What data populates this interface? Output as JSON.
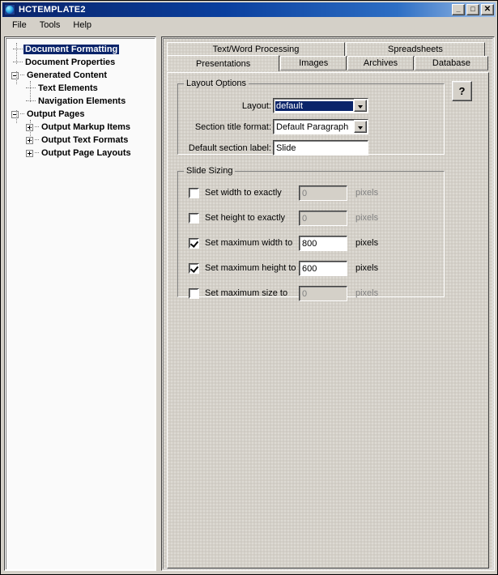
{
  "window": {
    "title": "HCTEMPLATE2",
    "icon": "globe-icon",
    "buttons": {
      "minimize": "_",
      "maximize": "□",
      "close": "✕"
    }
  },
  "menubar": {
    "items": [
      {
        "label": "File"
      },
      {
        "label": "Tools"
      },
      {
        "label": "Help"
      }
    ]
  },
  "tree": {
    "items": [
      {
        "label": "Document Formatting",
        "indent": 1,
        "toggle": "none",
        "selected": true
      },
      {
        "label": "Document Properties",
        "indent": 1,
        "toggle": "none",
        "selected": false
      },
      {
        "label": "Generated Content",
        "indent": 0,
        "toggle": "minus",
        "selected": false
      },
      {
        "label": "Text Elements",
        "indent": 2,
        "toggle": "none",
        "selected": false
      },
      {
        "label": "Navigation Elements",
        "indent": 2,
        "toggle": "none",
        "selected": false
      },
      {
        "label": "Output Pages",
        "indent": 0,
        "toggle": "minus",
        "selected": false
      },
      {
        "label": "Output Markup Items",
        "indent": 1,
        "toggle": "plus",
        "selected": false
      },
      {
        "label": "Output Text Formats",
        "indent": 1,
        "toggle": "plus",
        "selected": false
      },
      {
        "label": "Output Page Layouts",
        "indent": 1,
        "toggle": "plus",
        "selected": false
      }
    ]
  },
  "tabs": {
    "row1": [
      {
        "label": "Text/Word Processing",
        "active": false
      },
      {
        "label": "Spreadsheets",
        "active": false
      }
    ],
    "row2": [
      {
        "label": "Presentations",
        "active": true
      },
      {
        "label": "Images",
        "active": false
      },
      {
        "label": "Archives",
        "active": false
      },
      {
        "label": "Database",
        "active": false
      }
    ]
  },
  "help_button": {
    "label": "?"
  },
  "layout_options": {
    "title": "Layout Options",
    "layout": {
      "label": "Layout:",
      "value": "default",
      "focused": true
    },
    "section_title_format": {
      "label": "Section title format:",
      "value": "Default Paragraph",
      "focused": false
    },
    "default_section_label": {
      "label": "Default section label:",
      "value": "Slide"
    }
  },
  "slide_sizing": {
    "title": "Slide Sizing",
    "unit": "pixels",
    "rows": [
      {
        "label": "Set width to exactly",
        "checked": false,
        "value": "0",
        "enabled": false
      },
      {
        "label": "Set height to exactly",
        "checked": false,
        "value": "0",
        "enabled": false
      },
      {
        "label": "Set maximum width to",
        "checked": true,
        "value": "800",
        "enabled": true
      },
      {
        "label": "Set maximum height to",
        "checked": true,
        "value": "600",
        "enabled": true
      },
      {
        "label": "Set maximum size to",
        "checked": false,
        "value": "0",
        "enabled": false
      }
    ]
  },
  "colors": {
    "face": "#d4d0c8",
    "title_active": "#0a246a",
    "highlight": "#0a246a",
    "highlight_text": "#ffffff",
    "disabled_text": "#808080"
  }
}
